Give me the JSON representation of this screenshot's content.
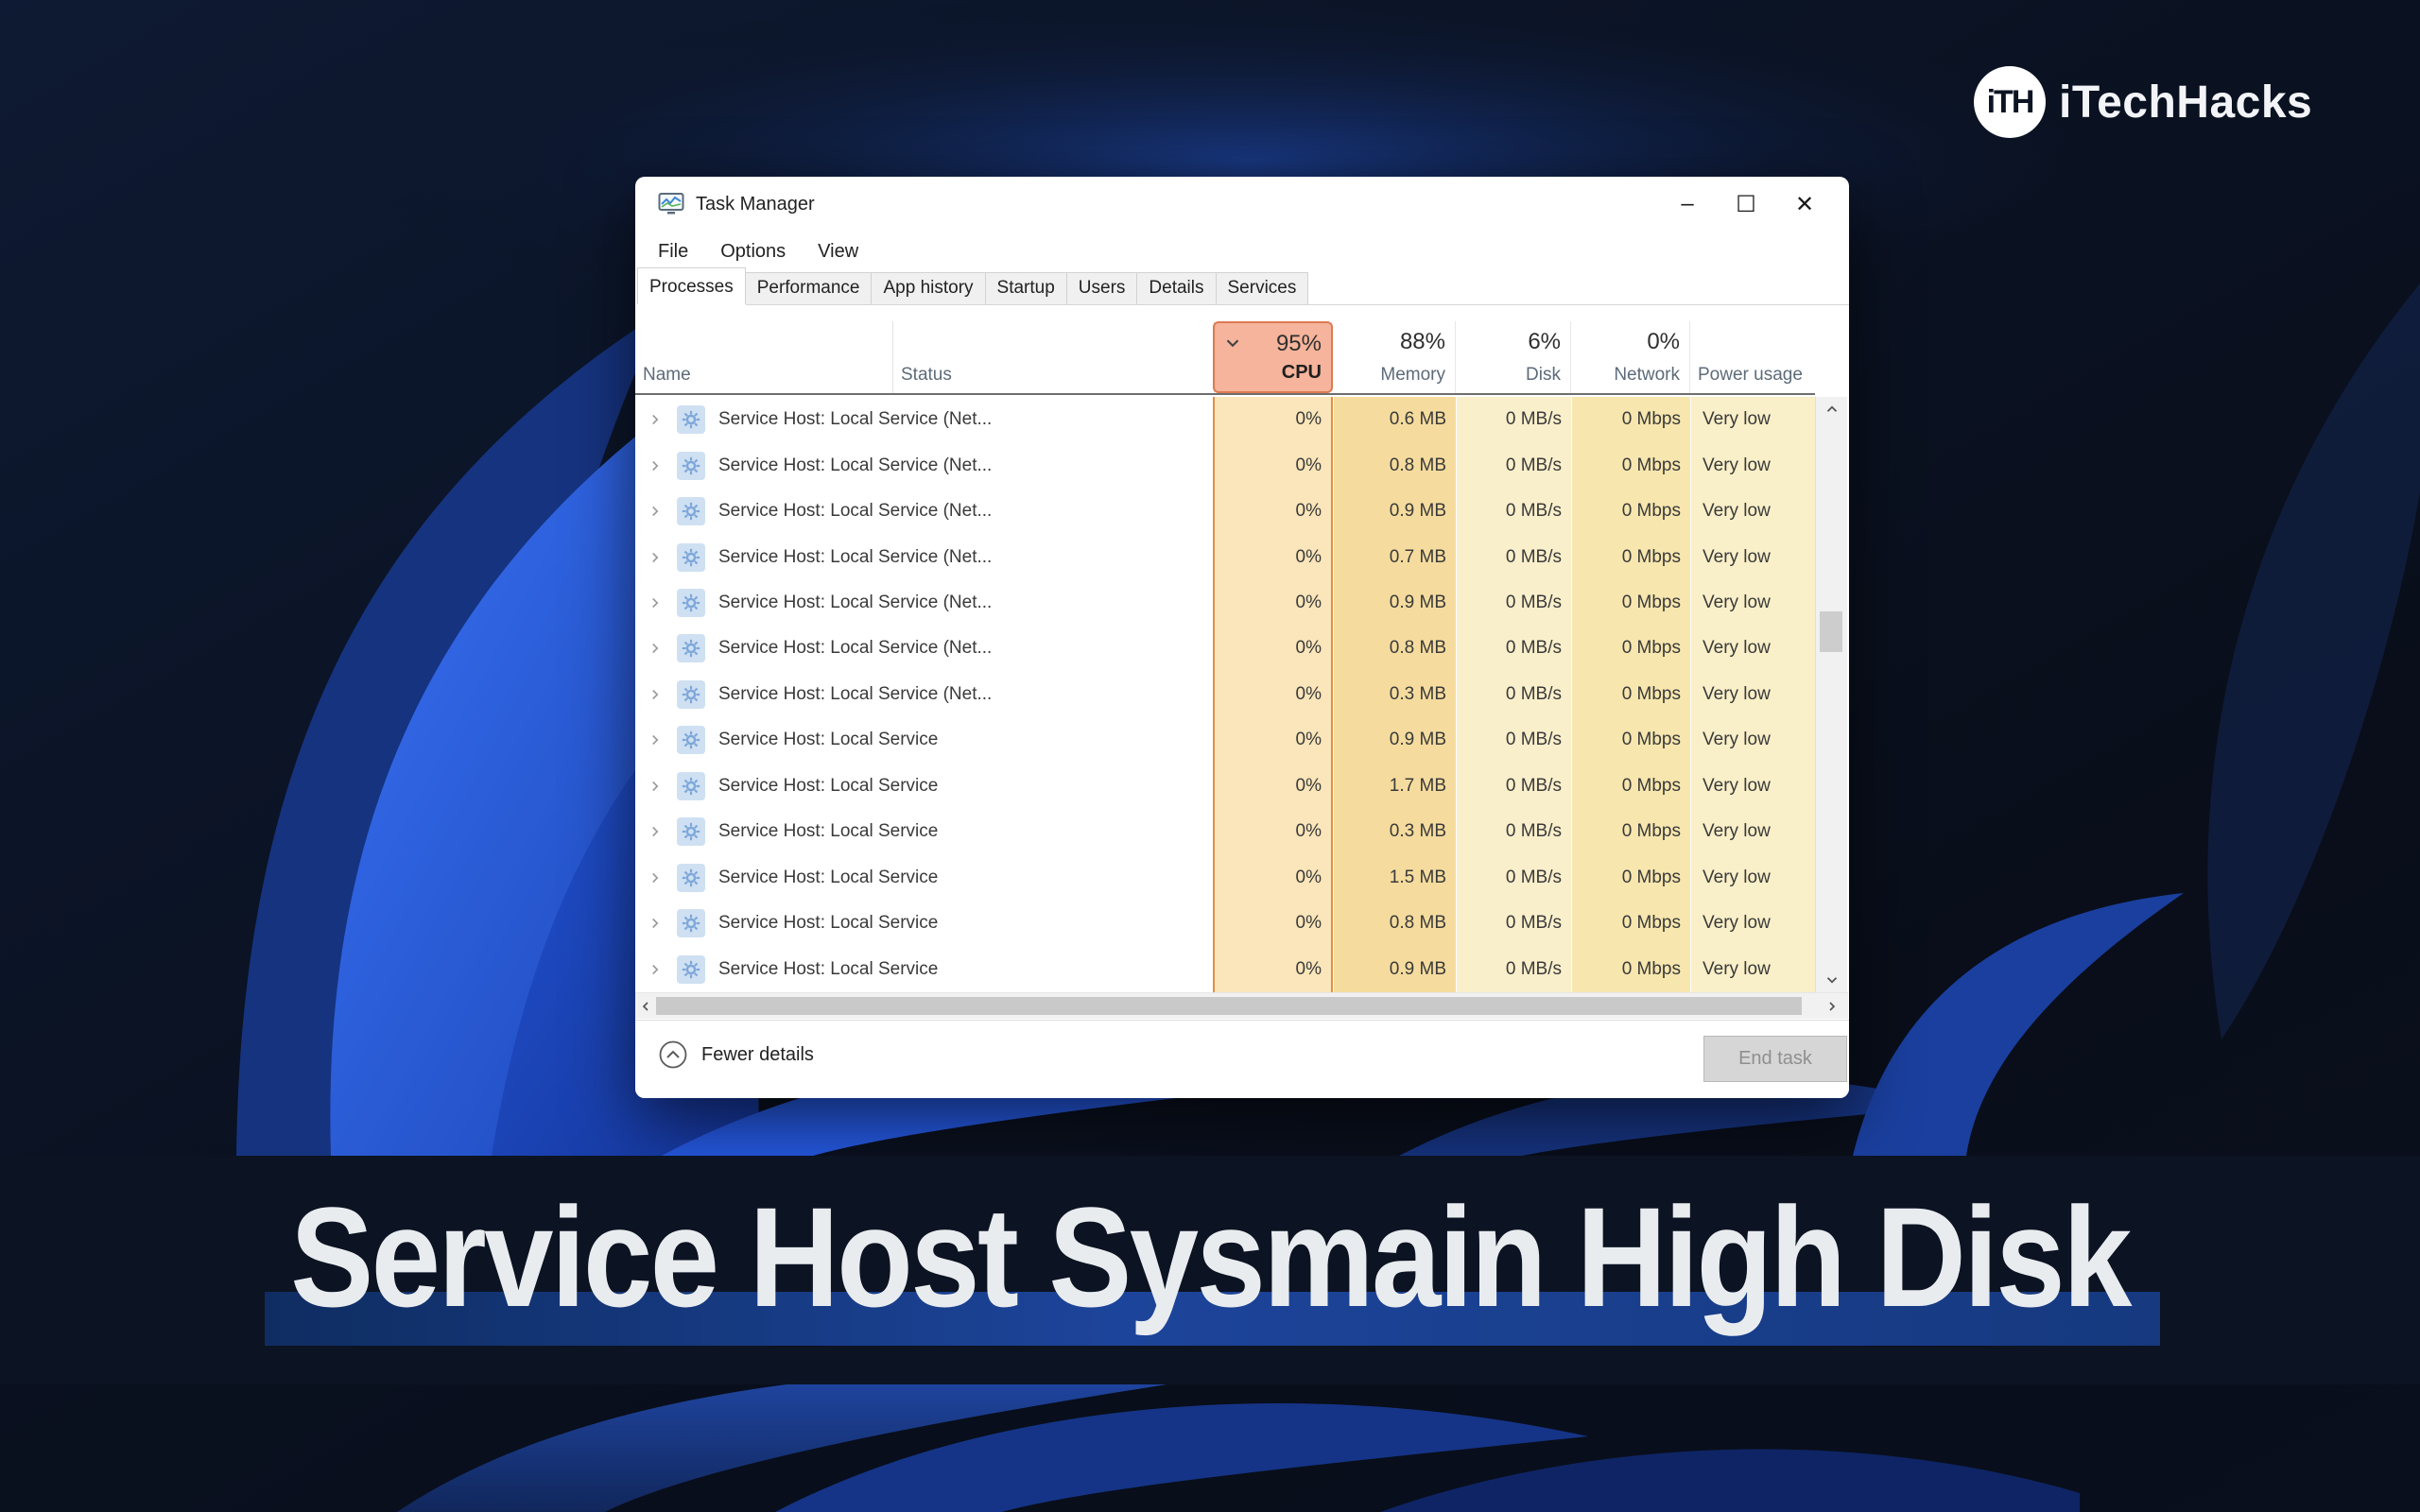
{
  "logo": {
    "monogram": "iTH",
    "name": "iTechHacks"
  },
  "banner": {
    "title": "Service Host Sysmain High Disk"
  },
  "taskManager": {
    "title": "Task Manager",
    "menu": [
      "File",
      "Options",
      "View"
    ],
    "window_controls": {
      "minimize": "–",
      "maximize": "☐",
      "close": "✕"
    },
    "tabs": [
      {
        "label": "Processes"
      },
      {
        "label": "Performance"
      },
      {
        "label": "App history"
      },
      {
        "label": "Startup"
      },
      {
        "label": "Users"
      },
      {
        "label": "Details"
      },
      {
        "label": "Services"
      }
    ],
    "header": {
      "name": "Name",
      "status": "Status",
      "cpu": {
        "percent": "95%",
        "label": "CPU"
      },
      "memory": {
        "percent": "88%",
        "label": "Memory"
      },
      "disk": {
        "percent": "6%",
        "label": "Disk"
      },
      "network": {
        "percent": "0%",
        "label": "Network"
      },
      "power": {
        "label": "Power usage"
      }
    },
    "rows": [
      {
        "name": "Service Host: Local Service (Net...",
        "status": "",
        "cpu": "0%",
        "memory": "0.6 MB",
        "disk": "0 MB/s",
        "network": "0 Mbps",
        "power": "Very low"
      },
      {
        "name": "Service Host: Local Service (Net...",
        "status": "",
        "cpu": "0%",
        "memory": "0.8 MB",
        "disk": "0 MB/s",
        "network": "0 Mbps",
        "power": "Very low"
      },
      {
        "name": "Service Host: Local Service (Net...",
        "status": "",
        "cpu": "0%",
        "memory": "0.9 MB",
        "disk": "0 MB/s",
        "network": "0 Mbps",
        "power": "Very low"
      },
      {
        "name": "Service Host: Local Service (Net...",
        "status": "",
        "cpu": "0%",
        "memory": "0.7 MB",
        "disk": "0 MB/s",
        "network": "0 Mbps",
        "power": "Very low"
      },
      {
        "name": "Service Host: Local Service (Net...",
        "status": "",
        "cpu": "0%",
        "memory": "0.9 MB",
        "disk": "0 MB/s",
        "network": "0 Mbps",
        "power": "Very low"
      },
      {
        "name": "Service Host: Local Service (Net...",
        "status": "",
        "cpu": "0%",
        "memory": "0.8 MB",
        "disk": "0 MB/s",
        "network": "0 Mbps",
        "power": "Very low"
      },
      {
        "name": "Service Host: Local Service (Net...",
        "status": "",
        "cpu": "0%",
        "memory": "0.3 MB",
        "disk": "0 MB/s",
        "network": "0 Mbps",
        "power": "Very low"
      },
      {
        "name": "Service Host: Local Service",
        "status": "",
        "cpu": "0%",
        "memory": "0.9 MB",
        "disk": "0 MB/s",
        "network": "0 Mbps",
        "power": "Very low"
      },
      {
        "name": "Service Host: Local Service",
        "status": "",
        "cpu": "0%",
        "memory": "1.7 MB",
        "disk": "0 MB/s",
        "network": "0 Mbps",
        "power": "Very low"
      },
      {
        "name": "Service Host: Local Service",
        "status": "",
        "cpu": "0%",
        "memory": "0.3 MB",
        "disk": "0 MB/s",
        "network": "0 Mbps",
        "power": "Very low"
      },
      {
        "name": "Service Host: Local Service",
        "status": "",
        "cpu": "0%",
        "memory": "1.5 MB",
        "disk": "0 MB/s",
        "network": "0 Mbps",
        "power": "Very low"
      },
      {
        "name": "Service Host: Local Service",
        "status": "",
        "cpu": "0%",
        "memory": "0.8 MB",
        "disk": "0 MB/s",
        "network": "0 Mbps",
        "power": "Very low"
      },
      {
        "name": "Service Host: Local Service",
        "status": "",
        "cpu": "0%",
        "memory": "0.9 MB",
        "disk": "0 MB/s",
        "network": "0 Mbps",
        "power": "Very low"
      }
    ],
    "footer": {
      "details": "Fewer details",
      "end_task": "End task"
    }
  }
}
